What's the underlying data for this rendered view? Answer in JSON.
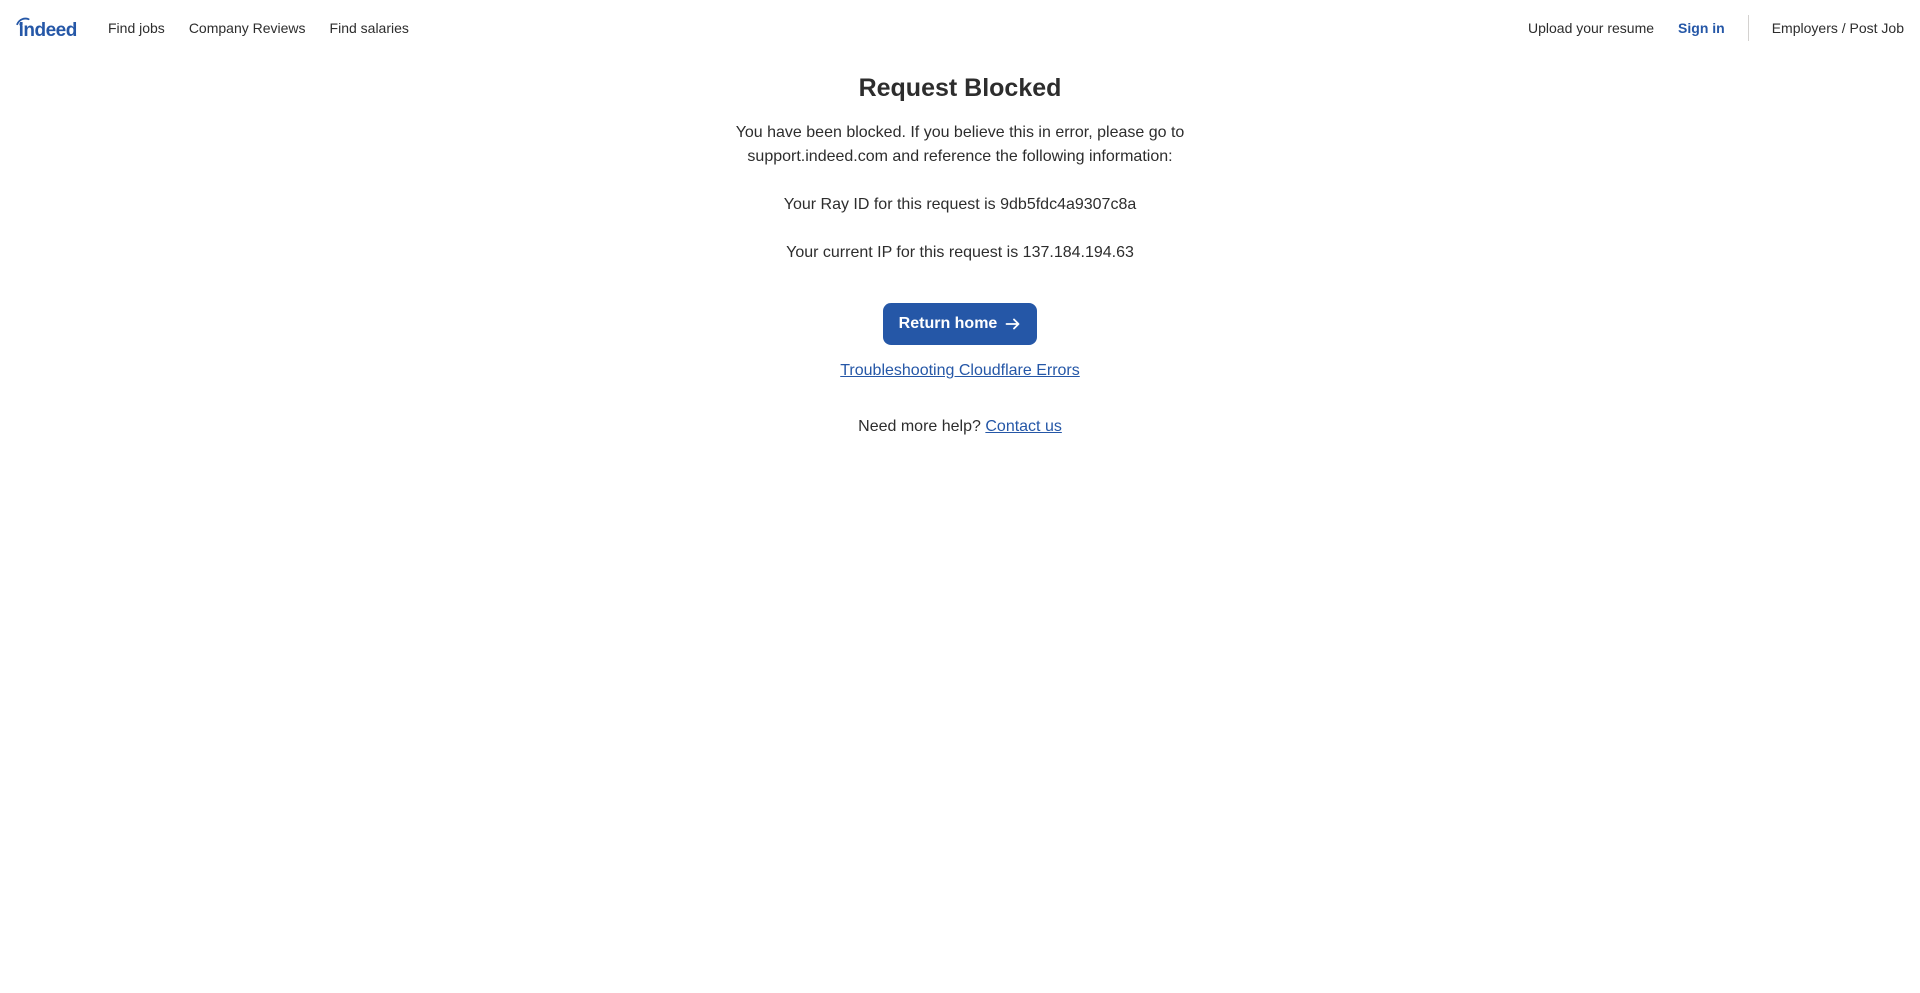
{
  "header": {
    "logo_text": "indeed",
    "nav_left": [
      {
        "label": "Find jobs"
      },
      {
        "label": "Company Reviews"
      },
      {
        "label": "Find salaries"
      }
    ],
    "upload_resume": "Upload your resume",
    "sign_in": "Sign in",
    "employers": "Employers / Post Job"
  },
  "main": {
    "title": "Request Blocked",
    "message": "You have been blocked. If you believe this in error, please go to support.indeed.com and reference the following information:",
    "ray_id_line": "Your Ray ID for this request is 9db5fdc4a9307c8a",
    "ip_line": "Your current IP for this request is 137.184.194.63",
    "return_button": "Return home",
    "return_icon": "arrow-right-icon",
    "troubleshoot_link": "Troubleshooting Cloudflare Errors",
    "help_text": "Need more help?",
    "contact_link": "Contact us"
  },
  "colors": {
    "brand": "#2557a7",
    "text": "#2d2d2d",
    "divider": "#d4d2d0"
  }
}
